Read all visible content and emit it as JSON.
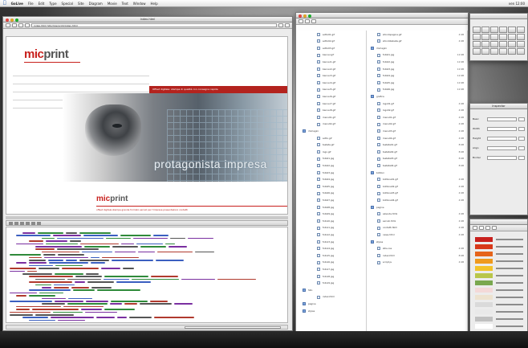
{
  "menubar": {
    "apple": "",
    "items": [
      "GoLive",
      "File",
      "Edit",
      "Type",
      "Special",
      "Site",
      "Diagram",
      "Movie",
      "Text",
      "Window",
      "Help"
    ],
    "clock": "ven 12:00"
  },
  "editor": {
    "title": "index.html",
    "address": "index.html  Sito/miscprint/index.html",
    "logo_mi": "mic",
    "logo_rest": "print",
    "red_band_text": "Offset digitale: stampa di qualità con consegna rapida",
    "headline": "protagonista impresa",
    "footer_logo_mi": "mic",
    "footer_logo_rest": "print",
    "footer_text": "offset digitale  stampa  grande formato  servizi per l'impresa  presentazioni  contatti"
  },
  "browser": {
    "colA": [
      {
        "label": "sotto01.gif",
        "size": "",
        "folder": false
      },
      {
        "label": "sotto02.gif",
        "size": "",
        "folder": false
      },
      {
        "label": "sotto03.gif",
        "size": "",
        "folder": false
      },
      {
        "label": "banner.gif",
        "size": "",
        "folder": false
      },
      {
        "label": "banner1.gif",
        "size": "",
        "folder": false
      },
      {
        "label": "banner2.gif",
        "size": "",
        "folder": false
      },
      {
        "label": "banner3.gif",
        "size": "",
        "folder": false
      },
      {
        "label": "banner4.gif",
        "size": "",
        "folder": false
      },
      {
        "label": "banner5.gif",
        "size": "",
        "folder": false
      },
      {
        "label": "banner6.gif",
        "size": "",
        "folder": false
      },
      {
        "label": "banner7.gif",
        "size": "",
        "folder": false
      },
      {
        "label": "banner8.gif",
        "size": "",
        "folder": false
      },
      {
        "label": "menu01.gif",
        "size": "",
        "folder": false
      },
      {
        "label": "menu02.gif",
        "size": "",
        "folder": false
      },
      {
        "label": "immagini",
        "size": "",
        "folder": true
      },
      {
        "label": "sotto.gif",
        "size": "",
        "folder": false
      },
      {
        "label": "testata.gif",
        "size": "",
        "folder": false
      },
      {
        "label": "logo.gif",
        "size": "",
        "folder": false
      },
      {
        "label": "foto01.jpg",
        "size": "",
        "folder": false
      },
      {
        "label": "foto02.jpg",
        "size": "",
        "folder": false
      },
      {
        "label": "foto03.jpg",
        "size": "",
        "folder": false
      },
      {
        "label": "foto04.jpg",
        "size": "",
        "folder": false
      },
      {
        "label": "foto05.jpg",
        "size": "",
        "folder": false
      },
      {
        "label": "foto06.jpg",
        "size": "",
        "folder": false
      },
      {
        "label": "foto07.jpg",
        "size": "",
        "folder": false
      },
      {
        "label": "foto08.jpg",
        "size": "",
        "folder": false
      },
      {
        "label": "foto09.jpg",
        "size": "",
        "folder": false
      },
      {
        "label": "foto10.jpg",
        "size": "",
        "folder": false
      },
      {
        "label": "foto11.jpg",
        "size": "",
        "folder": false
      },
      {
        "label": "foto12.jpg",
        "size": "",
        "folder": false
      },
      {
        "label": "foto13.jpg",
        "size": "",
        "folder": false
      },
      {
        "label": "foto14.jpg",
        "size": "",
        "folder": false
      },
      {
        "label": "foto15.jpg",
        "size": "",
        "folder": false
      },
      {
        "label": "foto16.jpg",
        "size": "",
        "folder": false
      },
      {
        "label": "foto17.jpg",
        "size": "",
        "folder": false
      },
      {
        "label": "foto18.jpg",
        "size": "",
        "folder": false
      },
      {
        "label": "foto19.jpg",
        "size": "",
        "folder": false
      },
      {
        "label": "Sito",
        "size": "",
        "folder": true
      },
      {
        "label": "index.html",
        "size": "",
        "folder": false
      },
      {
        "label": "pagine",
        "size": "",
        "folder": true
      },
      {
        "label": "styles",
        "size": "",
        "folder": true
      }
    ],
    "colB": [
      {
        "label": "sfondopagina.gif",
        "size": "4 KB",
        "folder": false
      },
      {
        "label": "sfondotabella.gif",
        "size": "4 KB",
        "folder": false
      },
      {
        "label": "immagini",
        "size": "",
        "folder": true
      },
      {
        "label": "foto01.jpg",
        "size": "12 KB",
        "folder": false
      },
      {
        "label": "foto02.jpg",
        "size": "12 KB",
        "folder": false
      },
      {
        "label": "foto03.jpg",
        "size": "12 KB",
        "folder": false
      },
      {
        "label": "foto04.jpg",
        "size": "12 KB",
        "folder": false
      },
      {
        "label": "foto05.jpg",
        "size": "12 KB",
        "folder": false
      },
      {
        "label": "foto06.jpg",
        "size": "12 KB",
        "folder": false
      },
      {
        "label": "grafica",
        "size": "",
        "folder": true
      },
      {
        "label": "logo01.gif",
        "size": "4 KB",
        "folder": false
      },
      {
        "label": "logo02.gif",
        "size": "4 KB",
        "folder": false
      },
      {
        "label": "menu01.gif",
        "size": "4 KB",
        "folder": false
      },
      {
        "label": "menu02.gif",
        "size": "4 KB",
        "folder": false
      },
      {
        "label": "menu03.gif",
        "size": "4 KB",
        "folder": false
      },
      {
        "label": "menu04.gif",
        "size": "4 KB",
        "folder": false
      },
      {
        "label": "testata01.gif",
        "size": "8 KB",
        "folder": false
      },
      {
        "label": "testata02.gif",
        "size": "8 KB",
        "folder": false
      },
      {
        "label": "testata03.gif",
        "size": "8 KB",
        "folder": false
      },
      {
        "label": "testata04.gif",
        "size": "8 KB",
        "folder": false
      },
      {
        "label": "bottoni",
        "size": "",
        "folder": true
      },
      {
        "label": "bottone01.gif",
        "size": "4 KB",
        "folder": false
      },
      {
        "label": "bottone02.gif",
        "size": "4 KB",
        "folder": false
      },
      {
        "label": "bottone03.gif",
        "size": "4 KB",
        "folder": false
      },
      {
        "label": "bottone04.gif",
        "size": "4 KB",
        "folder": false
      },
      {
        "label": "pagine",
        "size": "",
        "folder": true
      },
      {
        "label": "azienda.html",
        "size": "4 KB",
        "folder": false
      },
      {
        "label": "servizi.html",
        "size": "4 KB",
        "folder": false
      },
      {
        "label": "contatti.html",
        "size": "4 KB",
        "folder": false
      },
      {
        "label": "news.html",
        "size": "4 KB",
        "folder": false
      },
      {
        "label": "styles",
        "size": "",
        "folder": true
      },
      {
        "label": "stile.css",
        "size": "4 KB",
        "folder": false
      },
      {
        "label": "index.html",
        "size": "8 KB",
        "folder": false
      },
      {
        "label": "script.js",
        "size": "4 KB",
        "folder": false
      }
    ]
  },
  "inspector": {
    "title": "Inspector",
    "rows": [
      {
        "key": "Basic"
      },
      {
        "key": "Width"
      },
      {
        "key": "Height"
      },
      {
        "key": "Align"
      },
      {
        "key": "Border"
      }
    ]
  },
  "colors": {
    "swatches": [
      "#c8201d",
      "#d8391a",
      "#e5641b",
      "#ef9a1e",
      "#f3c32a",
      "#b9c64a",
      "#7aa84f",
      "#f4d9d8",
      "#ede2cf",
      "#dadada",
      "#e9e9e9",
      "#c0c0c0",
      "#ffffff"
    ]
  }
}
